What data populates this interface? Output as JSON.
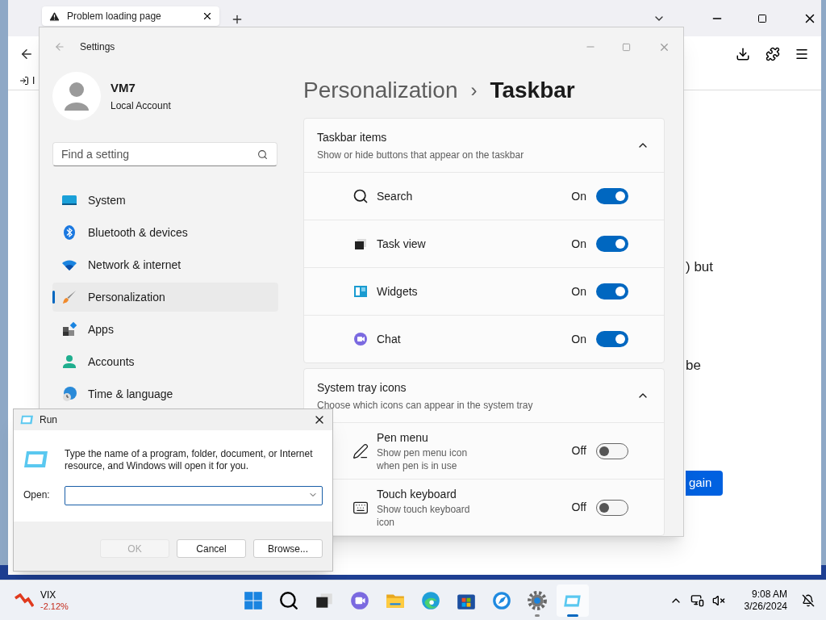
{
  "browser": {
    "tab": {
      "title": "Problem loading page"
    },
    "bookmark": "I",
    "content": {
      "fragments": [
        ") but",
        "be"
      ],
      "button": "gain"
    }
  },
  "settings": {
    "title": "Settings",
    "user": {
      "name": "VM7",
      "account": "Local Account"
    },
    "search": {
      "placeholder": "Find a setting"
    },
    "nav": [
      {
        "label": "System",
        "selected": false
      },
      {
        "label": "Bluetooth & devices",
        "selected": false
      },
      {
        "label": "Network & internet",
        "selected": false
      },
      {
        "label": "Personalization",
        "selected": true
      },
      {
        "label": "Apps",
        "selected": false
      },
      {
        "label": "Accounts",
        "selected": false
      },
      {
        "label": "Time & language",
        "selected": false
      }
    ],
    "breadcrumb": {
      "parent": "Personalization",
      "separator": "›",
      "current": "Taskbar"
    },
    "sections": [
      {
        "title": "Taskbar items",
        "subtitle": "Show or hide buttons that appear on the taskbar",
        "expanded": true,
        "items": [
          {
            "label": "Search",
            "state_label": "On",
            "on": true
          },
          {
            "label": "Task view",
            "state_label": "On",
            "on": true
          },
          {
            "label": "Widgets",
            "state_label": "On",
            "on": true
          },
          {
            "label": "Chat",
            "state_label": "On",
            "on": true
          }
        ]
      },
      {
        "title": "System tray icons",
        "subtitle": "Choose which icons can appear in the system tray",
        "expanded": true,
        "items": [
          {
            "label": "Pen menu",
            "description": "Show pen menu icon when pen is in use",
            "state_label": "Off",
            "on": false
          },
          {
            "label": "Touch keyboard",
            "description": "Show touch keyboard icon",
            "state_label": "Off",
            "on": false
          }
        ]
      }
    ]
  },
  "run": {
    "title": "Run",
    "description": "Type the name of a program, folder, document, or Internet resource, and Windows will open it for you.",
    "open_label": "Open:",
    "buttons": [
      {
        "label": "OK",
        "disabled": true
      },
      {
        "label": "Cancel",
        "disabled": false
      },
      {
        "label": "Browse...",
        "disabled": false
      }
    ]
  },
  "taskbar": {
    "widget": {
      "title": "VIX",
      "change": "-2.12%"
    },
    "apps": [
      {
        "running": false,
        "active": false
      },
      {
        "running": false,
        "active": false
      },
      {
        "running": false,
        "active": false
      },
      {
        "running": false,
        "active": false
      },
      {
        "running": false,
        "active": false
      },
      {
        "running": false,
        "active": false
      },
      {
        "running": false,
        "active": false
      },
      {
        "running": false,
        "active": false
      },
      {
        "running": true,
        "active": false
      },
      {
        "running": true,
        "active": true
      }
    ],
    "time": "9:08 AM",
    "date": "3/26/2024"
  }
}
